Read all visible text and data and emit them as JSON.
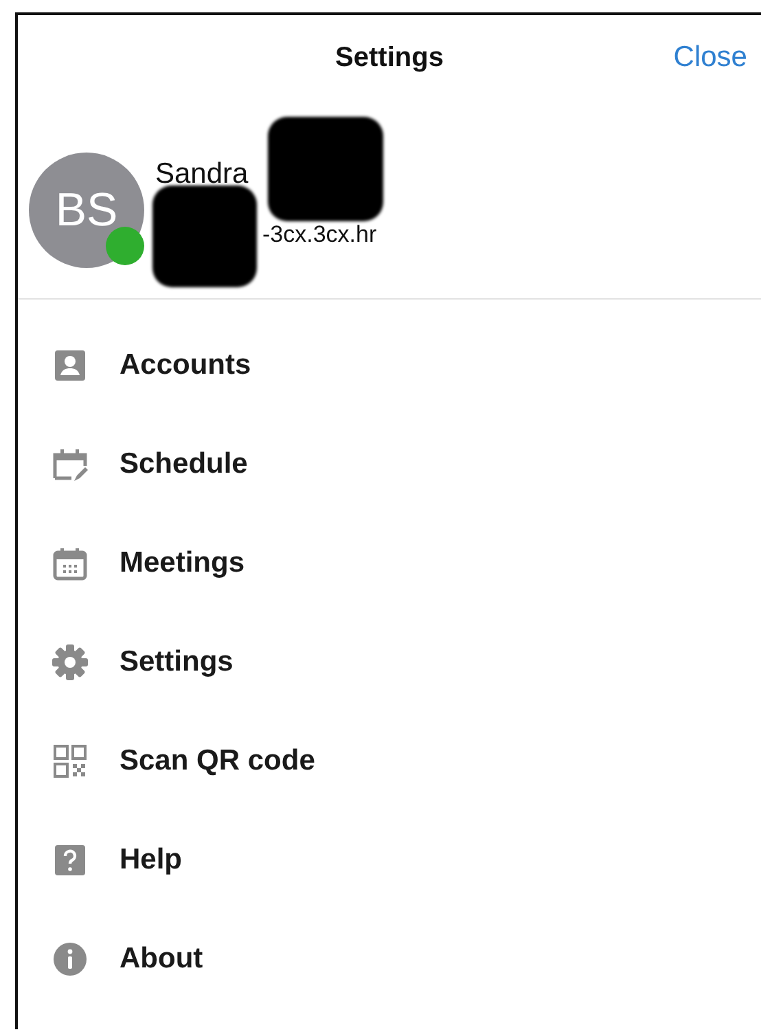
{
  "header": {
    "title": "Settings",
    "close": "Close"
  },
  "profile": {
    "initials": "BS",
    "online": true,
    "name": "Sandra",
    "host": "-3cx.3cx.hr"
  },
  "menu": [
    {
      "kind": "accounts",
      "label": "Accounts"
    },
    {
      "kind": "schedule",
      "label": "Schedule"
    },
    {
      "kind": "meetings",
      "label": "Meetings"
    },
    {
      "kind": "settings",
      "label": "Settings"
    },
    {
      "kind": "qr",
      "label": "Scan QR code"
    },
    {
      "kind": "help",
      "label": "Help"
    },
    {
      "kind": "about",
      "label": "About"
    }
  ]
}
